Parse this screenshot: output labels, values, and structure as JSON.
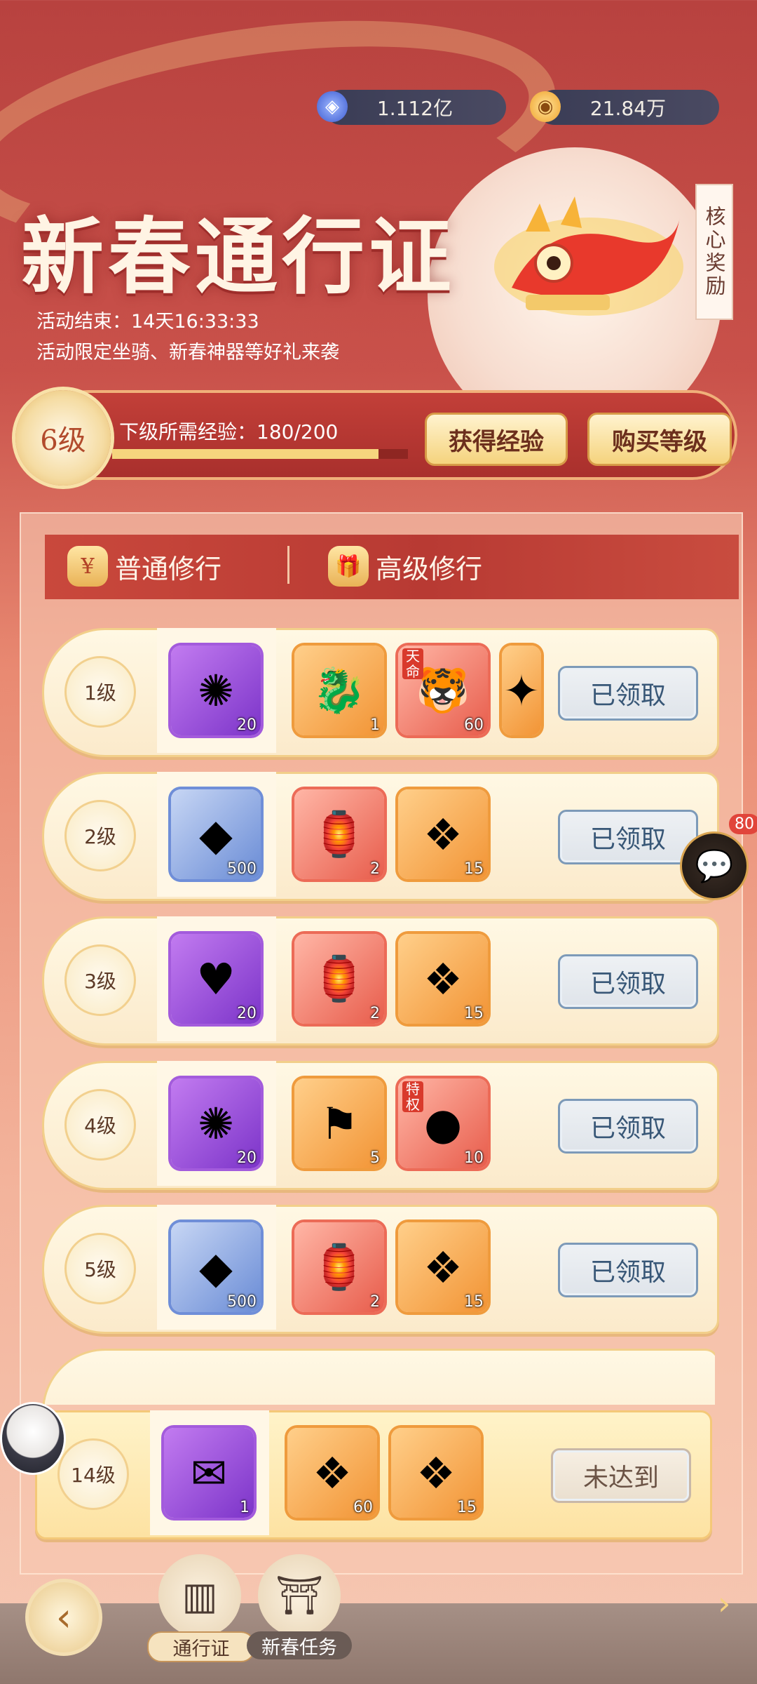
{
  "currency": [
    {
      "icon": "blue-jade-icon",
      "value": "1.112亿"
    },
    {
      "icon": "gold-coin-icon",
      "value": "21.84万"
    }
  ],
  "header": {
    "title": "新春通行证",
    "end_time": "活动结束：14天16:33:33",
    "desc": "活动限定坐骑、新春神器等好礼来袭",
    "core_reward": "核心奖励"
  },
  "level": {
    "current": "6级",
    "exp_label": "下级所需经验：180/200",
    "exp_progress": 0.9,
    "get_exp": "获得经验",
    "buy_level": "购买等级"
  },
  "tabs": {
    "normal": "普通修行",
    "premium": "高级修行"
  },
  "rows": [
    {
      "level": "1级",
      "free": {
        "style": "purple",
        "glyph": "✺",
        "num": "20"
      },
      "premium": [
        {
          "style": "orange",
          "glyph": "🐉",
          "num": "1"
        },
        {
          "style": "red",
          "glyph": "🐯",
          "num": "60",
          "tag": "天命"
        },
        {
          "style": "orange",
          "glyph": "✦",
          "num": ""
        }
      ],
      "status": "已领取"
    },
    {
      "level": "2级",
      "free": {
        "style": "blue",
        "glyph": "◆",
        "num": "500"
      },
      "premium": [
        {
          "style": "red",
          "glyph": "🏮",
          "num": "2"
        },
        {
          "style": "orange",
          "glyph": "❖",
          "num": "15"
        }
      ],
      "status": "已领取"
    },
    {
      "level": "3级",
      "free": {
        "style": "purple",
        "glyph": "♥",
        "num": "20"
      },
      "premium": [
        {
          "style": "red",
          "glyph": "🏮",
          "num": "2"
        },
        {
          "style": "orange",
          "glyph": "❖",
          "num": "15"
        }
      ],
      "status": "已领取"
    },
    {
      "level": "4级",
      "free": {
        "style": "purple",
        "glyph": "✺",
        "num": "20"
      },
      "premium": [
        {
          "style": "orange",
          "glyph": "⚑",
          "num": "5"
        },
        {
          "style": "red",
          "glyph": "●",
          "num": "10",
          "tag": "特权"
        }
      ],
      "status": "已领取"
    },
    {
      "level": "5级",
      "free": {
        "style": "blue",
        "glyph": "◆",
        "num": "500"
      },
      "premium": [
        {
          "style": "red",
          "glyph": "🏮",
          "num": "2"
        },
        {
          "style": "orange",
          "glyph": "❖",
          "num": "15"
        }
      ],
      "status": "已领取"
    }
  ],
  "sticky_row": {
    "level": "14级",
    "free": {
      "style": "purple",
      "glyph": "✉",
      "num": "1"
    },
    "premium": [
      {
        "style": "orange",
        "glyph": "❖",
        "num": "60"
      },
      {
        "style": "orange",
        "glyph": "❖",
        "num": "15"
      }
    ],
    "status": "未达到"
  },
  "chat_badge": "80",
  "nav": {
    "pass": "通行证",
    "tasks": "新春任务"
  }
}
